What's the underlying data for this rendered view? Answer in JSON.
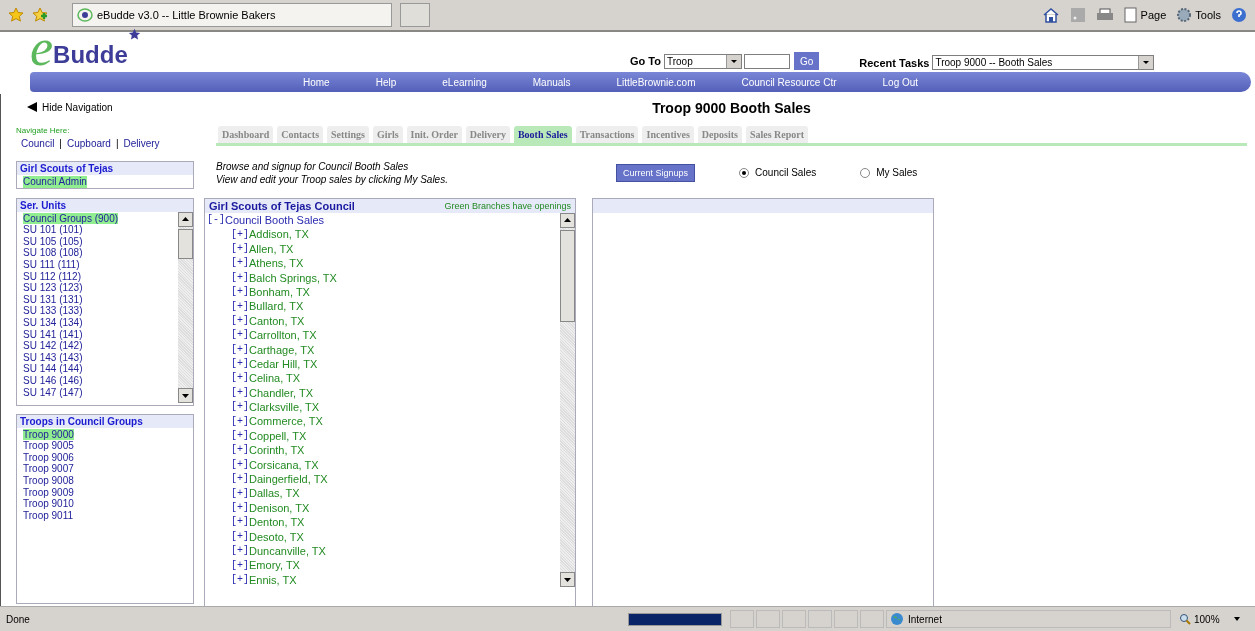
{
  "browser": {
    "tab_title": "eBudde v3.0 -- Little Brownie Bakers",
    "commands": [
      "Page",
      "Tools"
    ]
  },
  "header": {
    "logo": {
      "initial": "e",
      "name": "Budde"
    },
    "goto": {
      "label": "Go To",
      "select": "Troop",
      "button": "Go"
    },
    "recent": {
      "label": "Recent Tasks",
      "select": "Troop 9000 -- Booth Sales"
    },
    "nav_links": [
      "Home",
      "Help",
      "eLearning",
      "Manuals",
      "LittleBrownie.com",
      "Council Resource Ctr",
      "Log Out"
    ]
  },
  "sidebar": {
    "hide_nav": "Hide Navigation",
    "navigate_here": {
      "label": "Navigate Here:",
      "separator": "|",
      "links": [
        "Council",
        "Cupboard",
        "Delivery"
      ]
    },
    "council_panel": {
      "title": "Girl Scouts of Tejas",
      "items": [
        {
          "label": "Council Admin",
          "selected": true
        }
      ]
    },
    "ser_units": {
      "title": "Ser. Units",
      "items": [
        {
          "label": "Council Groups (900)",
          "selected": true
        },
        {
          "label": "SU 101 (101)",
          "selected": false
        },
        {
          "label": "SU 105 (105)",
          "selected": false
        },
        {
          "label": "SU 108 (108)",
          "selected": false
        },
        {
          "label": "SU 111 (111)",
          "selected": false
        },
        {
          "label": "SU 112 (112)",
          "selected": false
        },
        {
          "label": "SU 123 (123)",
          "selected": false
        },
        {
          "label": "SU 131 (131)",
          "selected": false
        },
        {
          "label": "SU 133 (133)",
          "selected": false
        },
        {
          "label": "SU 134 (134)",
          "selected": false
        },
        {
          "label": "SU 141 (141)",
          "selected": false
        },
        {
          "label": "SU 142 (142)",
          "selected": false
        },
        {
          "label": "SU 143 (143)",
          "selected": false
        },
        {
          "label": "SU 144 (144)",
          "selected": false
        },
        {
          "label": "SU 146 (146)",
          "selected": false
        },
        {
          "label": "SU 147 (147)",
          "selected": false
        }
      ]
    },
    "troops": {
      "title": "Troops in Council Groups",
      "items": [
        {
          "label": "Troop 9000",
          "selected": true
        },
        {
          "label": "Troop 9005",
          "selected": false
        },
        {
          "label": "Troop 9006",
          "selected": false
        },
        {
          "label": "Troop 9007",
          "selected": false
        },
        {
          "label": "Troop 9008",
          "selected": false
        },
        {
          "label": "Troop 9009",
          "selected": false
        },
        {
          "label": "Troop 9010",
          "selected": false
        },
        {
          "label": "Troop 9011",
          "selected": false
        }
      ]
    }
  },
  "content": {
    "title": "Troop 9000 Booth Sales",
    "tabs": [
      {
        "label": "Dashboard",
        "selected": false
      },
      {
        "label": "Contacts",
        "selected": false
      },
      {
        "label": "Settings",
        "selected": false
      },
      {
        "label": "Girls",
        "selected": false
      },
      {
        "label": "Init. Order",
        "selected": false
      },
      {
        "label": "Delivery",
        "selected": false
      },
      {
        "label": "Booth Sales",
        "selected": true
      },
      {
        "label": "Transactions",
        "selected": false
      },
      {
        "label": "Incentives",
        "selected": false
      },
      {
        "label": "Deposits",
        "selected": false
      },
      {
        "label": "Sales Report",
        "selected": false
      }
    ],
    "intro": [
      "Browse and signup for Council Booth Sales",
      "View and edit your Troop sales by clicking My Sales."
    ],
    "signups_button": "Current Signups",
    "radios": [
      {
        "label": "Council Sales",
        "selected": true
      },
      {
        "label": "My Sales",
        "selected": false
      }
    ],
    "tree": {
      "title": "Girl Scouts of Tejas Council",
      "note": "Green Branches have openings",
      "root": {
        "toggle": "[-]",
        "label": "Council Booth Sales",
        "has_openings": false,
        "children": [
          {
            "toggle": "[+]",
            "label": "Addison, TX",
            "has_openings": true
          },
          {
            "toggle": "[+]",
            "label": "Allen, TX",
            "has_openings": true
          },
          {
            "toggle": "[+]",
            "label": "Athens, TX",
            "has_openings": true
          },
          {
            "toggle": "[+]",
            "label": "Balch Springs, TX",
            "has_openings": true
          },
          {
            "toggle": "[+]",
            "label": "Bonham, TX",
            "has_openings": true
          },
          {
            "toggle": "[+]",
            "label": "Bullard, TX",
            "has_openings": true
          },
          {
            "toggle": "[+]",
            "label": "Canton, TX",
            "has_openings": true
          },
          {
            "toggle": "[+]",
            "label": "Carrollton, TX",
            "has_openings": true
          },
          {
            "toggle": "[+]",
            "label": "Carthage, TX",
            "has_openings": true
          },
          {
            "toggle": "[+]",
            "label": "Cedar Hill, TX",
            "has_openings": true
          },
          {
            "toggle": "[+]",
            "label": "Celina, TX",
            "has_openings": true
          },
          {
            "toggle": "[+]",
            "label": "Chandler, TX",
            "has_openings": true
          },
          {
            "toggle": "[+]",
            "label": "Clarksville, TX",
            "has_openings": true
          },
          {
            "toggle": "[+]",
            "label": "Commerce, TX",
            "has_openings": true
          },
          {
            "toggle": "[+]",
            "label": "Coppell, TX",
            "has_openings": true
          },
          {
            "toggle": "[+]",
            "label": "Corinth, TX",
            "has_openings": true
          },
          {
            "toggle": "[+]",
            "label": "Corsicana, TX",
            "has_openings": true
          },
          {
            "toggle": "[+]",
            "label": "Daingerfield, TX",
            "has_openings": true
          },
          {
            "toggle": "[+]",
            "label": "Dallas, TX",
            "has_openings": true
          },
          {
            "toggle": "[+]",
            "label": "Denison, TX",
            "has_openings": true
          },
          {
            "toggle": "[+]",
            "label": "Denton, TX",
            "has_openings": true
          },
          {
            "toggle": "[+]",
            "label": "Desoto, TX",
            "has_openings": true
          },
          {
            "toggle": "[+]",
            "label": "Duncanville, TX",
            "has_openings": true
          },
          {
            "toggle": "[+]",
            "label": "Emory, TX",
            "has_openings": true
          },
          {
            "toggle": "[+]",
            "label": "Ennis, TX",
            "has_openings": true
          }
        ]
      }
    }
  },
  "status_bar": {
    "text": "Done",
    "progress": {
      "level": 1
    },
    "zone": "Internet",
    "zoom": "100%"
  }
}
